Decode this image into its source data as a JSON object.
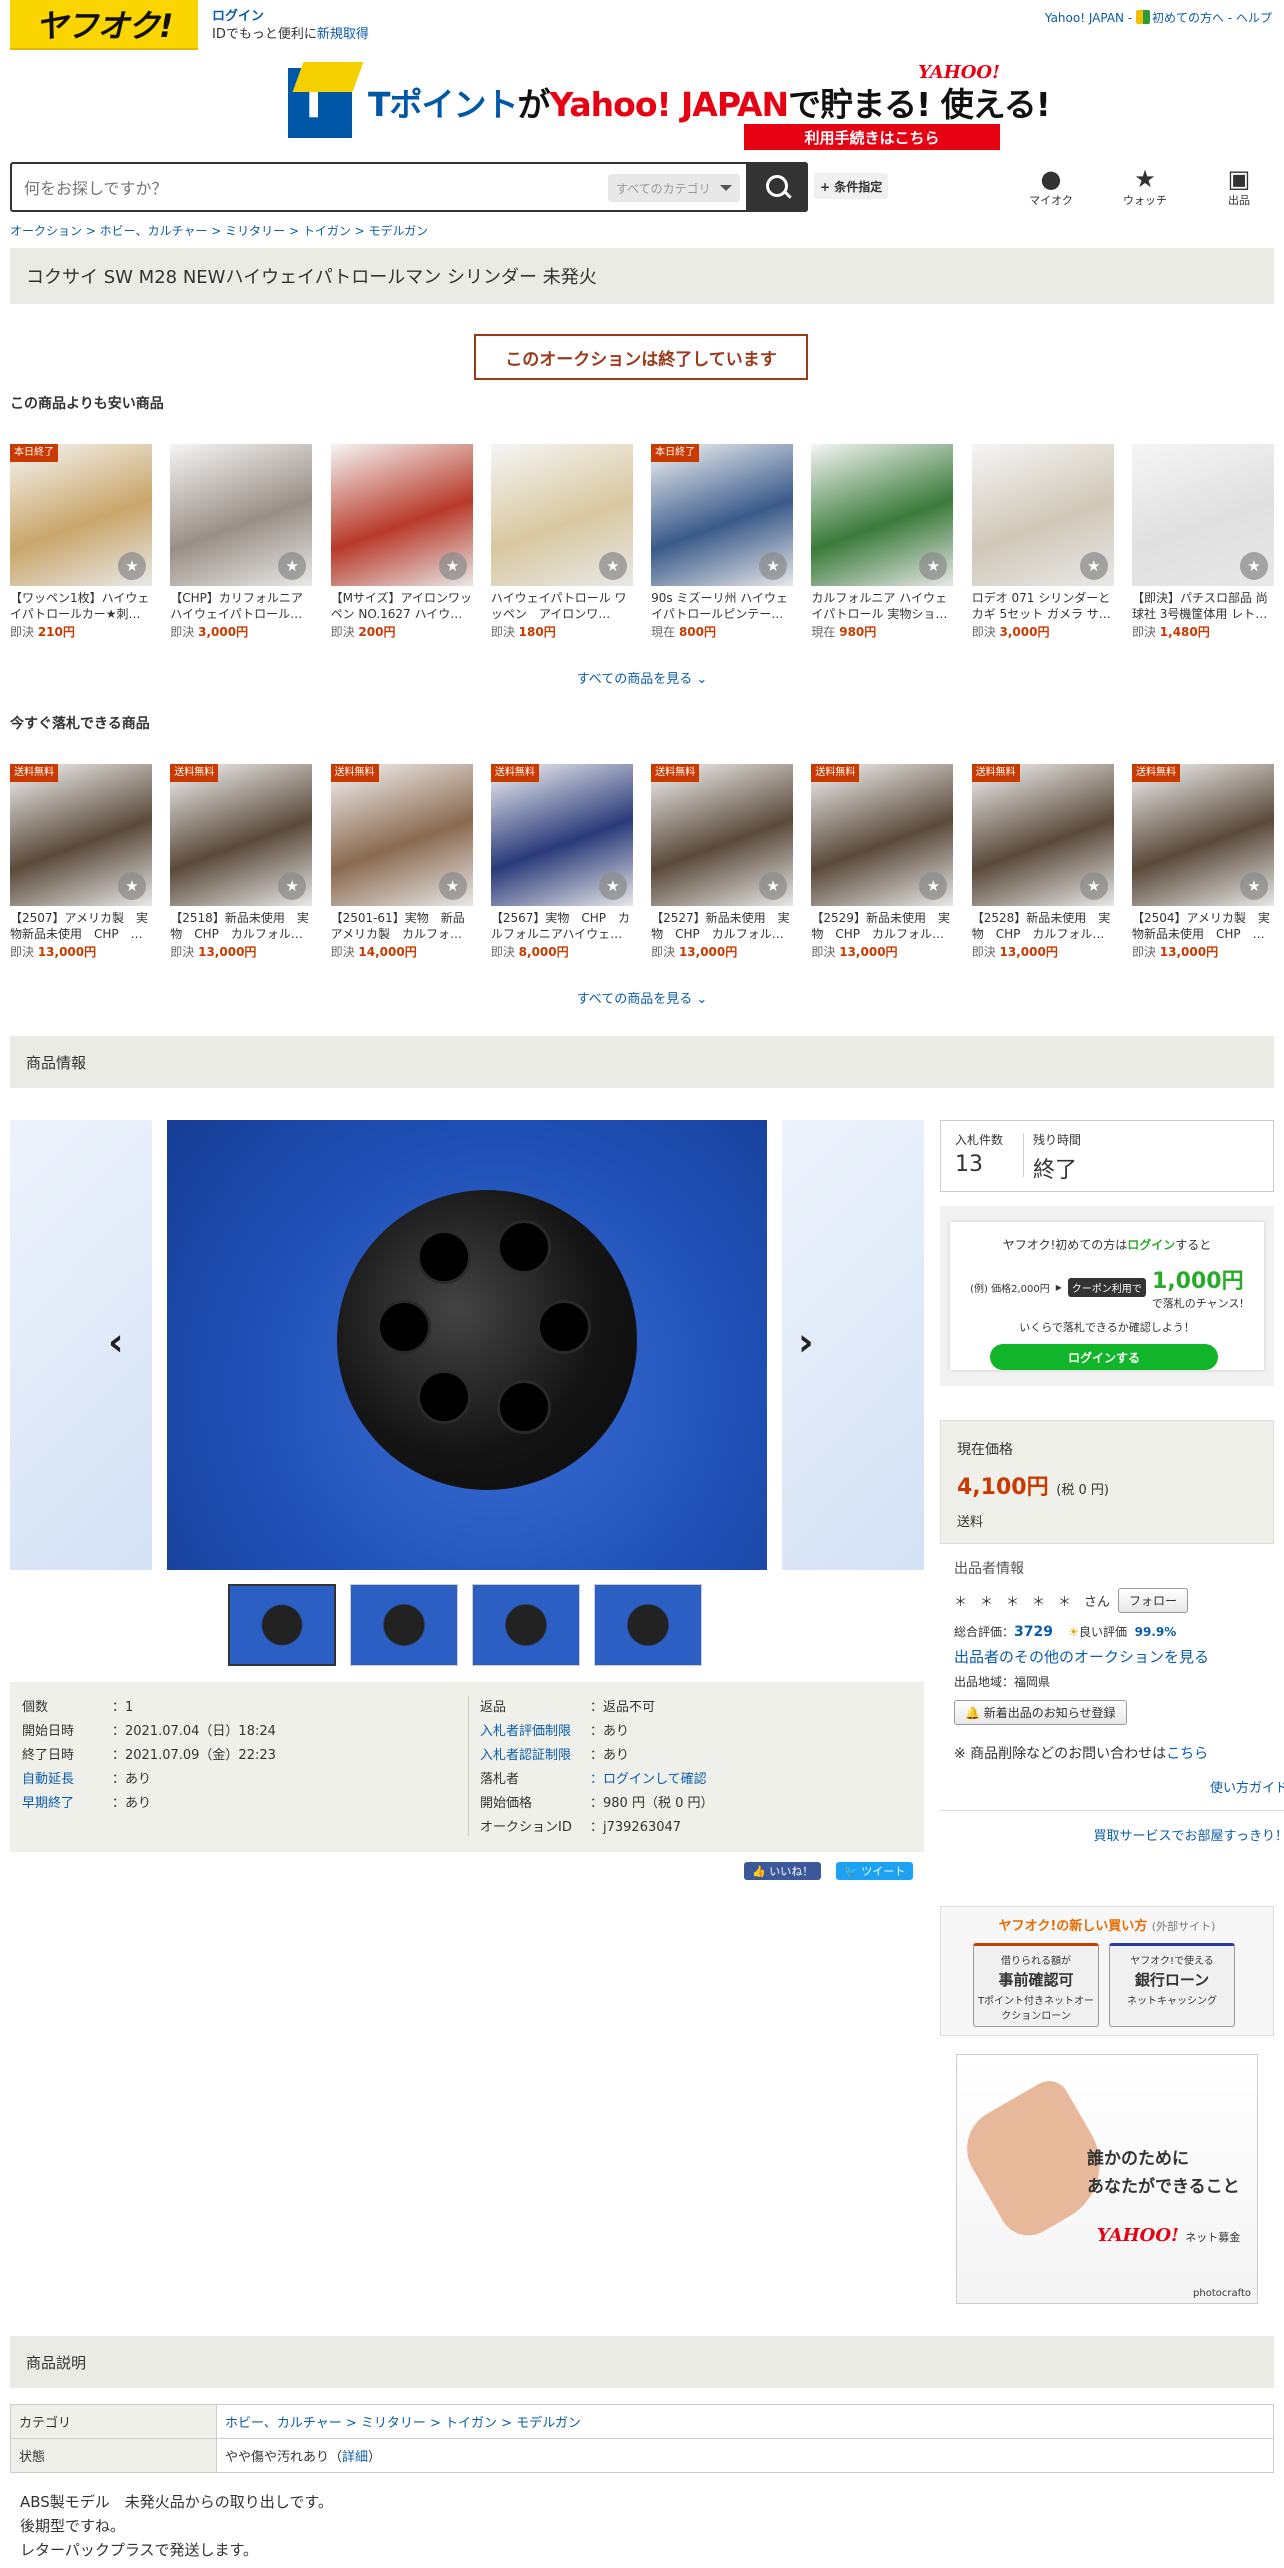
{
  "header": {
    "logo_text": "ヤフオク!",
    "login_label": "ログイン",
    "login_sub_prefix": "IDでもっと便利に",
    "register_label": "新規取得",
    "top_links": [
      "Yahoo! JAPAN",
      "初めての方へ",
      "ヘルプ"
    ]
  },
  "banner": {
    "text_part1": "Tポイント",
    "text_part2": "が",
    "text_part3": "Yahoo! JAPAN",
    "text_part4": "で貯まる! 使える!",
    "logo": "YAHOO!",
    "cta": "利用手続きはこちら"
  },
  "search": {
    "placeholder": "何をお探しですか？",
    "category": "すべてのカテゴリ",
    "advanced": "+ 条件指定"
  },
  "nav": [
    {
      "label": "マイオク",
      "icon": "user-icon"
    },
    {
      "label": "ウォッチ",
      "icon": "star-icon"
    },
    {
      "label": "出品",
      "icon": "camera-icon"
    }
  ],
  "breadcrumb": "オークション > ホビー、カルチャー > ミリタリー > トイガン > モデルガン",
  "item_title": "コクサイ SW M28 NEWハイウェイパトロールマン シリンダー 未発火",
  "ended_label": "このオークションは終了しています",
  "cheaper_section": {
    "title": "この商品よりも安い商品",
    "see_all": "すべての商品を見る",
    "items": [
      {
        "name": "【ワッペン1枚】ハイウェイパトロールカー★刺…",
        "price_label": "即決",
        "price": "210円",
        "tag": "本日終了",
        "color": "#c9a66a"
      },
      {
        "name": "【CHP】カリフォルニア ハイウェイパトロール…",
        "price_label": "即決",
        "price": "3,000円",
        "tag": "",
        "color": "#9a8f86"
      },
      {
        "name": "【Mサイズ】アイロンワッペン NO.1627 ハイウ…",
        "price_label": "即決",
        "price": "200円",
        "tag": "",
        "color": "#b83a2a"
      },
      {
        "name": "ハイウェイパトロール ワッペン　アイロンワ…",
        "price_label": "即決",
        "price": "180円",
        "tag": "",
        "color": "#d8c8a0"
      },
      {
        "name": "90s ミズーリ州 ハイウェイパトロールピンテー…",
        "price_label": "現在",
        "price": "800円",
        "tag": "本日終了",
        "color": "#3a5a8a"
      },
      {
        "name": "カルフォルニア ハイウェイパトロール 実物ショ…",
        "price_label": "現在",
        "price": "980円",
        "tag": "",
        "color": "#3a7a3a"
      },
      {
        "name": "ロデオ 071 シリンダーとカギ 5セット ガメラ サ…",
        "price_label": "即決",
        "price": "3,000円",
        "tag": "",
        "color": "#d0c8b8"
      },
      {
        "name": "【即決】パチスロ部品 尚球社 3号機筐体用 レト…",
        "price_label": "即決",
        "price": "1,480円",
        "tag": "",
        "color": "#e0e0e0"
      }
    ]
  },
  "buynow_section": {
    "title": "今すぐ落札できる商品",
    "see_all": "すべての商品を見る",
    "items": [
      {
        "name": "【2507】アメリカ製　実物新品未使用　CHP　…",
        "price_label": "即決",
        "price": "13,000円",
        "tag": "送料無料",
        "color": "#5a4a3a"
      },
      {
        "name": "【2518】新品未使用　実物　CHP　カルフォル…",
        "price_label": "即決",
        "price": "13,000円",
        "tag": "送料無料",
        "color": "#5a4a3a"
      },
      {
        "name": "【2501-61】実物　新品　アメリカ製　カルフォ…",
        "price_label": "即決",
        "price": "14,000円",
        "tag": "送料無料",
        "color": "#8a6a50"
      },
      {
        "name": "【2567】実物　CHP　カルフォルニアハイウェ…",
        "price_label": "即決",
        "price": "8,000円",
        "tag": "送料無料",
        "color": "#2a3a7a"
      },
      {
        "name": "【2527】新品未使用　実物　CHP　カルフォル…",
        "price_label": "即決",
        "price": "13,000円",
        "tag": "送料無料",
        "color": "#5a4a3a"
      },
      {
        "name": "【2529】新品未使用　実物　CHP　カルフォル…",
        "price_label": "即決",
        "price": "13,000円",
        "tag": "送料無料",
        "color": "#5a4a3a"
      },
      {
        "name": "【2528】新品未使用　実物　CHP　カルフォル…",
        "price_label": "即決",
        "price": "13,000円",
        "tag": "送料無料",
        "color": "#5a4a3a"
      },
      {
        "name": "【2504】アメリカ製　実物新品未使用　CHP　…",
        "price_label": "即決",
        "price": "13,000円",
        "tag": "送料無料",
        "color": "#5a4a3a"
      }
    ]
  },
  "product_info_title": "商品情報",
  "details_left": [
    {
      "k": "個数",
      "v": "1",
      "k_link": false,
      "v_link": false
    },
    {
      "k": "開始日時",
      "v": "2021.07.04（日）18:24",
      "k_link": false,
      "v_link": false
    },
    {
      "k": "終了日時",
      "v": "2021.07.09（金）22:23",
      "k_link": false,
      "v_link": false
    },
    {
      "k": "自動延長",
      "v": "あり",
      "k_link": true,
      "v_link": false
    },
    {
      "k": "早期終了",
      "v": "あり",
      "k_link": true,
      "v_link": false
    }
  ],
  "details_right": [
    {
      "k": "返品",
      "v": "返品不可",
      "k_link": false,
      "v_link": false
    },
    {
      "k": "入札者評価制限",
      "v": "あり",
      "k_link": true,
      "v_link": false
    },
    {
      "k": "入札者認証制限",
      "v": "あり",
      "k_link": true,
      "v_link": false
    },
    {
      "k": "落札者",
      "v": "ログインして確認",
      "k_link": false,
      "v_link": true
    },
    {
      "k": "開始価格",
      "v": "980 円（税 0 円）",
      "k_link": false,
      "v_link": false
    },
    {
      "k": "オークションID",
      "v": "j739263047",
      "k_link": false,
      "v_link": false
    }
  ],
  "social": {
    "like": "いいね！",
    "tweet": "ツイート"
  },
  "bid_status": {
    "bids_label": "入札件数",
    "bids": "13",
    "time_label": "残り時間",
    "time": "終了"
  },
  "coupon": {
    "line1_prefix": "ヤフオク!初めての方は",
    "line1_link": "ログイン",
    "line1_suffix": "すると",
    "example": "(例) 価格2,000円",
    "badge": "クーポン利用で",
    "amount": "1,000円",
    "amount_suffix": "で落札のチャンス!",
    "note": "いくらで落札できるか確認しよう！",
    "button": "ログインする"
  },
  "price": {
    "label": "現在価格",
    "value": "4,100円",
    "tax": "(税 0 円)",
    "shipping": "送料"
  },
  "seller": {
    "title": "出品者情報",
    "name": "＊　＊　＊　＊　＊　さん",
    "follow": "フォロー",
    "rating_label": "総合評価：",
    "rating": "3729",
    "good_label": "良い評価",
    "good_pct": "99.9%",
    "other_link": "出品者のその他のオークションを見る",
    "region": "出品地域：福岡県",
    "notify": "新着出品のお知らせ登録"
  },
  "inquiry_prefix": "※ 商品削除などのお問い合わせは",
  "inquiry_link": "こちら",
  "guide_link": "使い方ガイド",
  "buy_service_link": "買取サービスでお部屋すっきり！",
  "promo": {
    "title": "ヤフオク!の新しい買い方",
    "external": "(外部サイト)",
    "btn1_top": "借りられる額が",
    "btn1_main": "事前確認可",
    "btn1_sub": "Tポイント付きネットオークションローン",
    "btn2_top": "ヤフオク!で使える",
    "btn2_main": "銀行ローン",
    "btn2_sub": "ネットキャッシング"
  },
  "ad": {
    "line1": "誰かのために",
    "line2": "あなたができること",
    "logo": "YAHOO!",
    "sub": "ネット募金",
    "credit": "photocrafto"
  },
  "description_title": "商品説明",
  "desc_table": [
    {
      "k": "カテゴリ",
      "v": "ホビー、カルチャー > ミリタリー > トイガン > モデルガン",
      "link": true
    },
    {
      "k": "状態",
      "v": "やや傷や汚れあり",
      "detail": "詳細",
      "link": false
    }
  ],
  "description_lines": [
    "ABS製モデル　未発火品からの取り出しです。",
    "後期型ですね。",
    "レターパックプラスで発送します。"
  ]
}
